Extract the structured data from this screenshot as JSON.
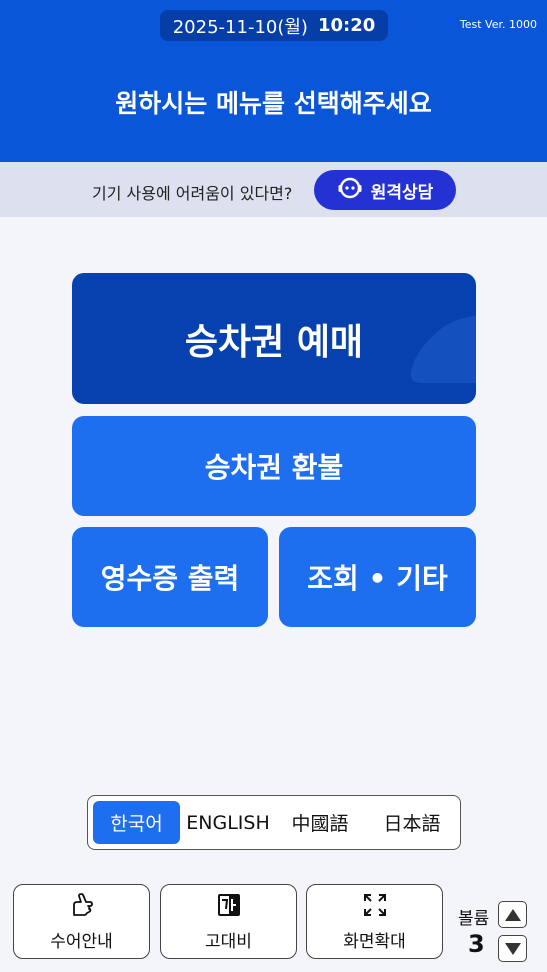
{
  "header": {
    "date": "2025-11-10(월)",
    "time": "10:20",
    "version": "Test Ver. 1000",
    "title": "원하시는 메뉴를 선택해주세요"
  },
  "help": {
    "text": "기기 사용에 어려움이 있다면?",
    "remote_label": "원격상담",
    "remote_icon": "headset-face-icon"
  },
  "menu": {
    "buy": "승차권 예매",
    "refund": "승차권 환불",
    "receipt": "영수증 출력",
    "inquiry": "조회 • 기타"
  },
  "languages": {
    "items": [
      "한국어",
      "ENGLISH",
      "中國語",
      "日本語"
    ],
    "selected": "한국어"
  },
  "bottom": {
    "sign_language": "수어안내",
    "high_contrast": "고대비",
    "zoom": "화면확대",
    "volume_label": "볼륨",
    "volume_value": "3"
  },
  "colors": {
    "header_bg": "#0956d9",
    "primary": "#1e6ef0",
    "dark_primary": "#0741b0",
    "remote_btn": "#2432d3"
  }
}
